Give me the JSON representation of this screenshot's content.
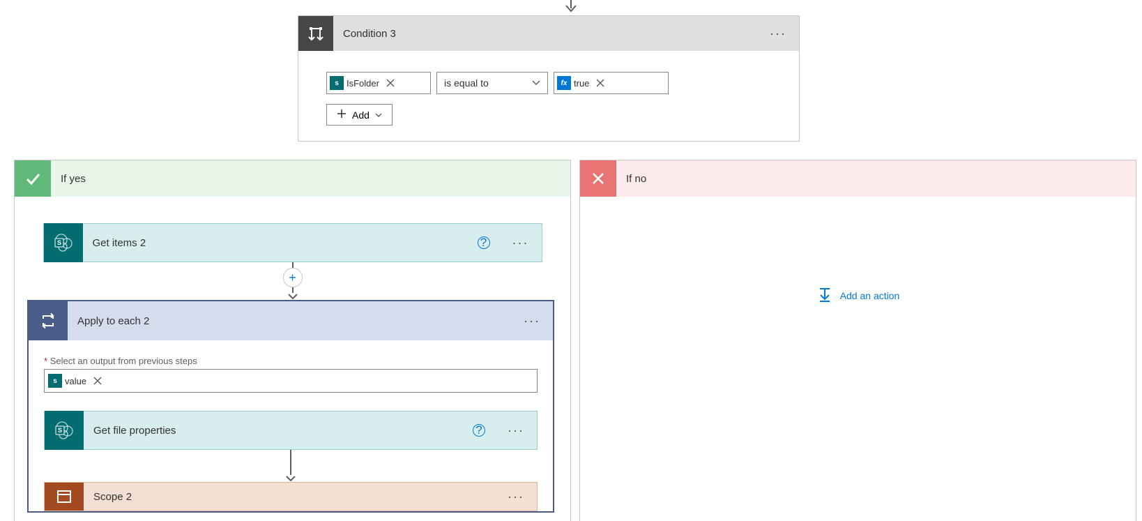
{
  "condition": {
    "title": "Condition 3",
    "field_token": "IsFolder",
    "operator": "is equal to",
    "value_token": "true",
    "add_label": "Add"
  },
  "branches": {
    "yes": {
      "title": "If yes"
    },
    "no": {
      "title": "If no",
      "add_action_label": "Add an action"
    }
  },
  "actions": {
    "get_items": {
      "title": "Get items 2"
    },
    "apply_each": {
      "title": "Apply to each 2",
      "field_label": "Select an output from previous steps",
      "token": "value"
    },
    "get_file_props": {
      "title": "Get file properties"
    },
    "scope": {
      "title": "Scope 2"
    }
  }
}
